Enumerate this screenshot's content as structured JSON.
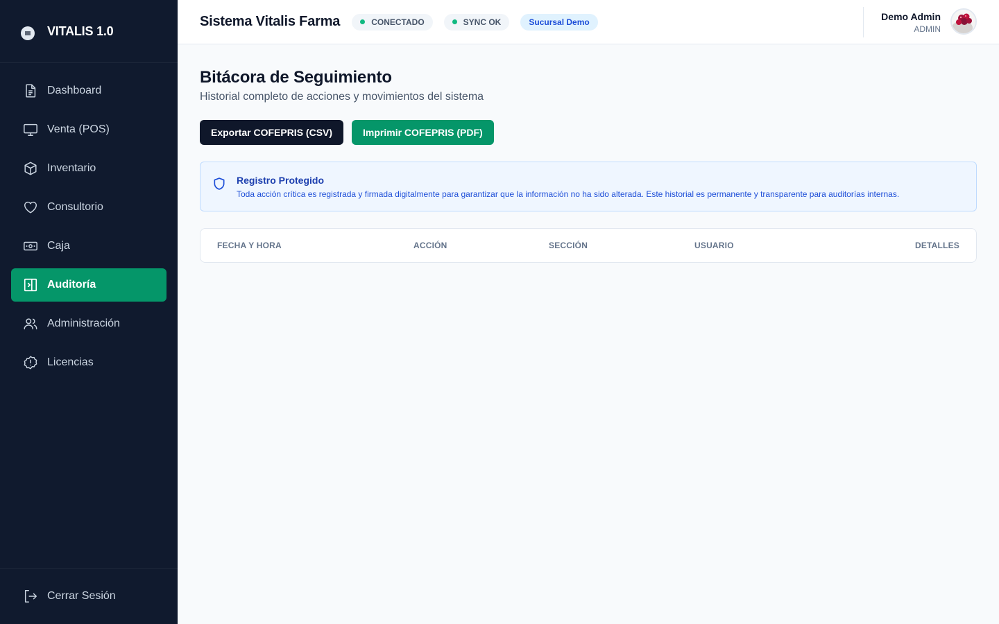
{
  "brand": {
    "name": "VITALIS 1.0"
  },
  "sidebar": {
    "items": [
      {
        "label": "Dashboard",
        "icon": "document-icon",
        "active": false
      },
      {
        "label": "Venta (POS)",
        "icon": "monitor-icon",
        "active": false
      },
      {
        "label": "Inventario",
        "icon": "box-icon",
        "active": false
      },
      {
        "label": "Consultorio",
        "icon": "heart-icon",
        "active": false
      },
      {
        "label": "Caja",
        "icon": "banknote-icon",
        "active": false
      },
      {
        "label": "Auditoría",
        "icon": "panel-icon",
        "active": true
      },
      {
        "label": "Administración",
        "icon": "users-icon",
        "active": false
      },
      {
        "label": "Licencias",
        "icon": "alert-badge-icon",
        "active": false
      }
    ],
    "logout_label": "Cerrar Sesión"
  },
  "header": {
    "title": "Sistema Vitalis Farma",
    "status_connected": "CONECTADO",
    "status_sync": "SYNC OK",
    "branch": "Sucursal Demo",
    "user_name": "Demo Admin",
    "user_role": "ADMIN"
  },
  "main": {
    "title": "Bitácora de Seguimiento",
    "subtitle": "Historial completo de acciones y movimientos del sistema",
    "export_csv_label": "Exportar COFEPRIS (CSV)",
    "print_pdf_label": "Imprimir COFEPRIS (PDF)",
    "notice_title": "Registro Protegido",
    "notice_text": "Toda acción crítica es registrada y firmada digitalmente para garantizar que la información no ha sido alterada. Este historial es permanente y transparente para auditorías internas.",
    "table_headers": [
      "Fecha y Hora",
      "Acción",
      "Sección",
      "Usuario",
      "Detalles"
    ]
  },
  "colors": {
    "sidebar_bg": "#101a2e",
    "accent_green": "#059669",
    "dark_button": "#0f172a",
    "notice_bg": "#eff6ff"
  }
}
